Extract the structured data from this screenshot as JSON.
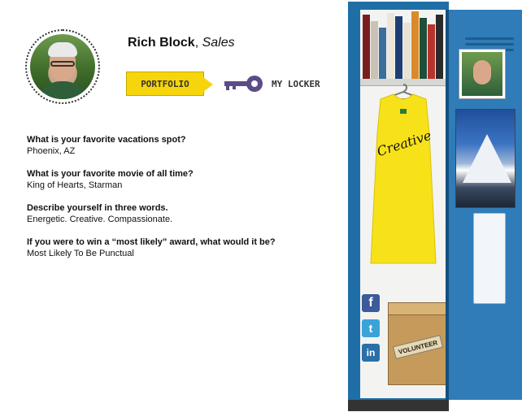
{
  "profile": {
    "name": "Rich Block",
    "separator": ",",
    "role": "Sales"
  },
  "nav": {
    "portfolio_label": "PORTFOLIO",
    "locker_label": "MY LOCKER"
  },
  "qa": [
    {
      "question": "What is your favorite vacations spot?",
      "answer": "Phoenix, AZ"
    },
    {
      "question": "What is your favorite movie of all time?",
      "answer": "King of Hearts, Starman"
    },
    {
      "question": "Describe yourself in three words.",
      "answer": "Energetic. Creative. Compassionate."
    },
    {
      "question": "If you were to win a “most likely” award, what would it be?",
      "answer": "Most Likely To Be Punctual"
    }
  ],
  "locker": {
    "shirt_text": "Creative",
    "box_label": "VOLUNTEER",
    "social": {
      "facebook": "f",
      "twitter": "t",
      "linkedin": "in"
    }
  },
  "colors": {
    "locker_blue": "#1f6fa6",
    "tab_yellow": "#f6d50c",
    "key_purple": "#5b4b86"
  }
}
